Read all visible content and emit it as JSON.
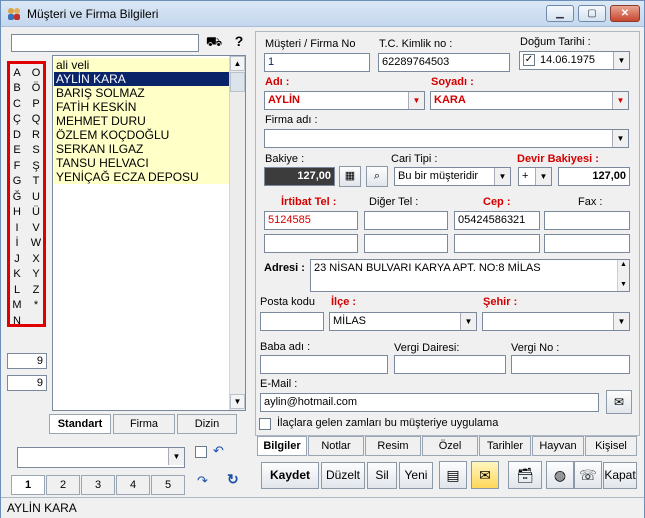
{
  "window": {
    "title": "Müşteri ve Firma Bilgileri",
    "min": "▁",
    "max": "▢",
    "close": "✕"
  },
  "search": {
    "value": ""
  },
  "letters_left": [
    "A",
    "B",
    "C",
    "Ç",
    "D",
    "E",
    "F",
    "G",
    "Ğ",
    "H",
    "I",
    "İ",
    "J",
    "K",
    "L",
    "M",
    "N"
  ],
  "letters_right": [
    "O",
    "Ö",
    "P",
    "Q",
    "R",
    "S",
    "Ş",
    "T",
    "U",
    "Ü",
    "V",
    "W",
    "X",
    "Y",
    "Z",
    "*"
  ],
  "counts": [
    "9",
    "9"
  ],
  "list": {
    "items": [
      "ali veli",
      "AYLİN KARA",
      "BARIŞ SOLMAZ",
      "FATİH KESKİN",
      "MEHMET DURU",
      "ÖZLEM KOÇDOĞLU",
      "SERKAN ILGAZ",
      "TANSU HELVACI",
      "YENİÇAĞ ECZA DEPOSU"
    ],
    "selected": 1
  },
  "list_tabs": [
    "Standart",
    "Firma",
    "Dizin"
  ],
  "page_tabs": [
    "1",
    "2",
    "3",
    "4",
    "5"
  ],
  "form": {
    "musteri_no_label": "Müşteri / Firma No",
    "musteri_no": "1",
    "tc_label": "T.C. Kimlik no :",
    "tc": "62289764503",
    "dogum_label": "Doğum Tarihi :",
    "dogum": "14.06.1975",
    "adi_label": "Adı :",
    "adi": "AYLİN",
    "soyadi_label": "Soyadı :",
    "soyadi": "KARA",
    "firma_label": "Firma adı :",
    "firma": "",
    "bakiye_label": "Bakiye :",
    "bakiye": "127,00",
    "cari_label": "Cari Tipi :",
    "cari": "Bu bir müşteridir",
    "devir_label": "Devir Bakiyesi :",
    "devir_sign": "+",
    "devir": "127,00",
    "irtibat_label": "İrtibat Tel :",
    "irtibat": "5124585",
    "diger_label": "Diğer Tel :",
    "cep_label": "Cep :",
    "cep": "05424586321",
    "fax_label": "Fax :",
    "adres_label": "Adresi :",
    "adres": "23 NİSAN BULVARI KARYA APT. NO:8 MİLAS",
    "posta_label": "Posta kodu",
    "ilce_label": "İlçe :",
    "ilce": "MİLAS",
    "sehir_label": "Şehir :",
    "baba_label": "Baba adı :",
    "vergi_dairesi_label": "Vergi Dairesi:",
    "vergi_no_label": "Vergi No :",
    "email_label": "E-Mail :",
    "email": "aylin@hotmail.com",
    "ilac_label": "İlaçlara gelen zamları bu müşteriye uygulama"
  },
  "form_tabs": [
    "Bilgiler",
    "Notlar",
    "Resim",
    "Özel",
    "Tarihler",
    "Hayvan",
    "Kişisel"
  ],
  "actions": {
    "kaydet": "Kaydet",
    "duzelt": "Düzelt",
    "sil": "Sil",
    "yeni": "Yeni",
    "kapat": "Kapat"
  },
  "status": {
    "text": "AYLİN KARA"
  },
  "colors": {
    "accent_red": "#d40000",
    "selection": "#0a246a",
    "list_bg": "#ffffc8"
  }
}
